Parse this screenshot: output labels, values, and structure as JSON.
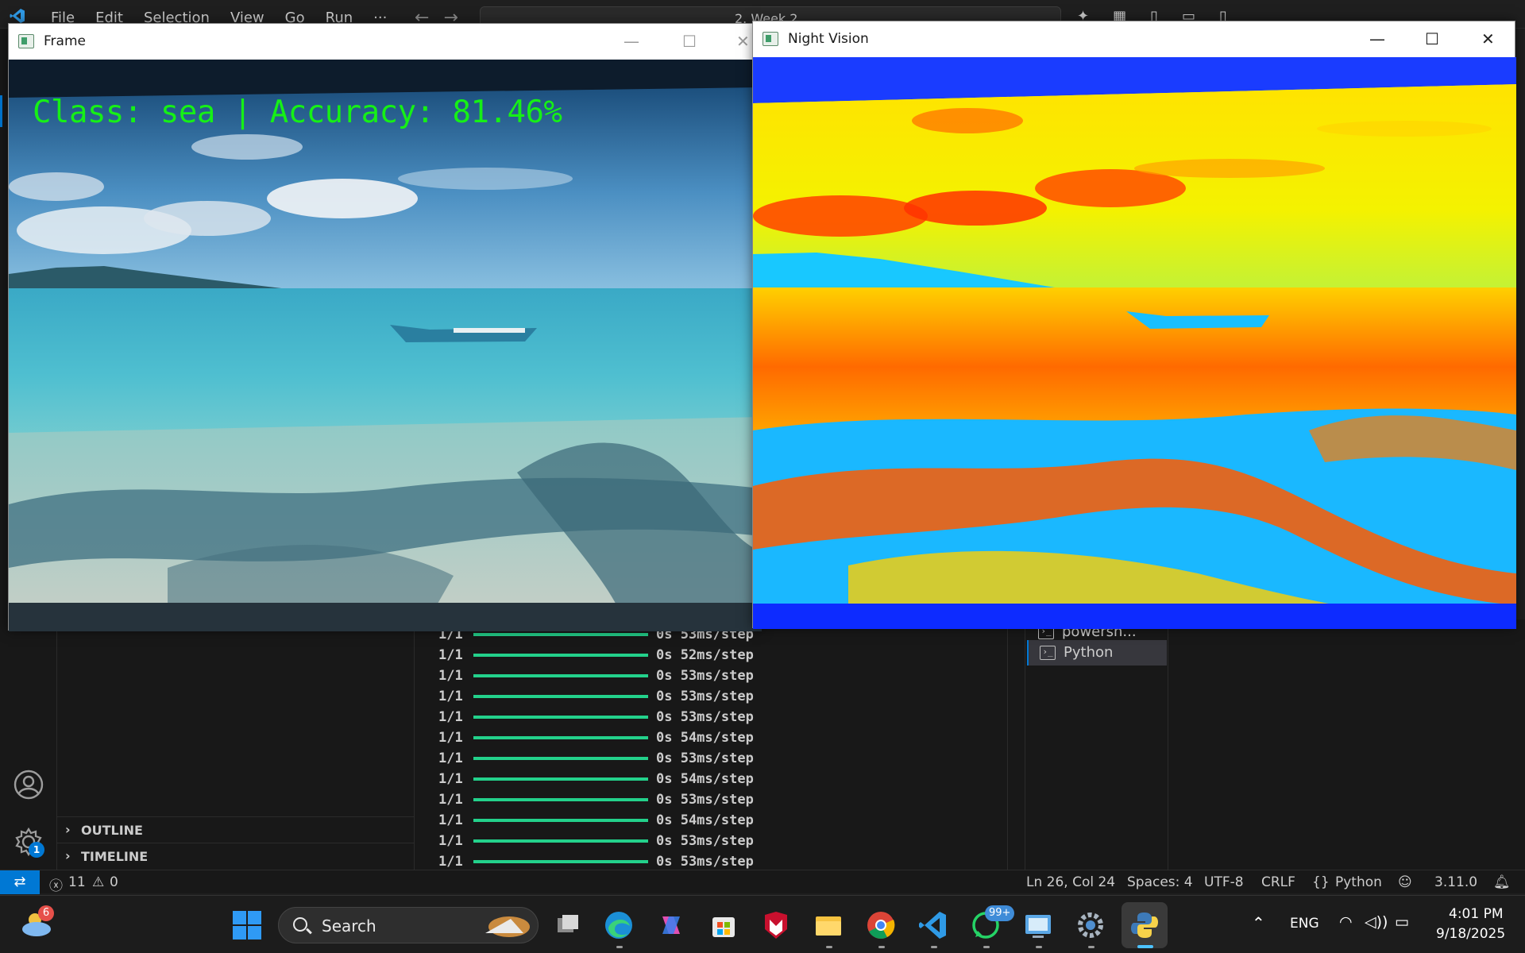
{
  "vscode": {
    "menu": [
      "File",
      "Edit",
      "Selection",
      "View",
      "Go",
      "Run",
      "···"
    ],
    "search_text": "2. Week 2"
  },
  "sidebar": {
    "sections": [
      {
        "label": "OUTLINE"
      },
      {
        "label": "TIMELINE"
      }
    ],
    "settings_badge": "1"
  },
  "terminal": {
    "lines": [
      {
        "step": "1/1",
        "time": "0s 53ms/step"
      },
      {
        "step": "1/1",
        "time": "0s 52ms/step"
      },
      {
        "step": "1/1",
        "time": "0s 53ms/step"
      },
      {
        "step": "1/1",
        "time": "0s 53ms/step"
      },
      {
        "step": "1/1",
        "time": "0s 53ms/step"
      },
      {
        "step": "1/1",
        "time": "0s 54ms/step"
      },
      {
        "step": "1/1",
        "time": "0s 53ms/step"
      },
      {
        "step": "1/1",
        "time": "0s 54ms/step"
      },
      {
        "step": "1/1",
        "time": "0s 53ms/step"
      },
      {
        "step": "1/1",
        "time": "0s 54ms/step"
      },
      {
        "step": "1/1",
        "time": "0s 53ms/step"
      },
      {
        "step": "1/1",
        "time": "0s 53ms/step"
      }
    ],
    "tabs": [
      {
        "label": "powersh...",
        "active": false
      },
      {
        "label": "Python",
        "active": true
      }
    ]
  },
  "statusbar": {
    "errors": "11",
    "warnings": "0",
    "position": "Ln 26, Col 24",
    "spaces": "Spaces: 4",
    "encoding": "UTF-8",
    "eol": "CRLF",
    "language": "Python",
    "python_version": "3.11.0"
  },
  "windows": {
    "frame": {
      "title": "Frame",
      "overlay": "Class: sea | Accuracy: 81.46%"
    },
    "night_vision": {
      "title": "Night Vision"
    }
  },
  "taskbar": {
    "weather_badge": "6",
    "search_placeholder": "Search",
    "whatsapp_badge": "99+",
    "language": "ENG",
    "time": "4:01 PM",
    "date": "9/18/2025"
  },
  "colors": {
    "accent": "#0078d4",
    "progress_bar": "#23d18b",
    "overlay_text": "#16f016"
  }
}
